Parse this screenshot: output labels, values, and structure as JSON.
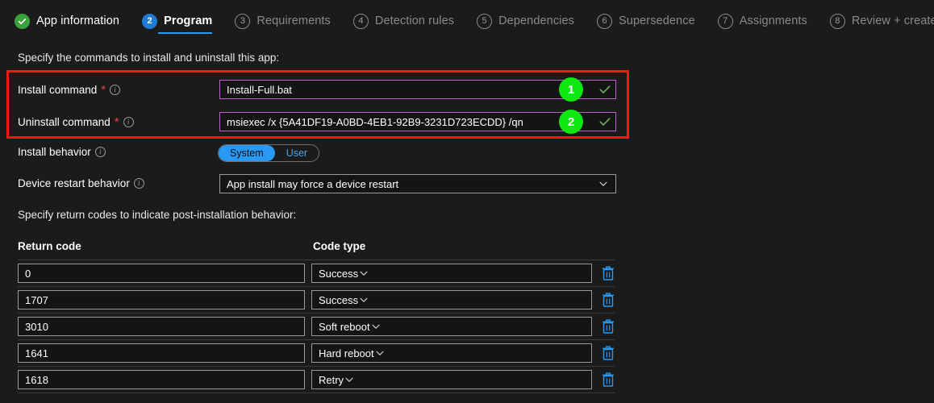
{
  "wizard": {
    "steps": [
      {
        "num": "",
        "label": "App information",
        "state": "done",
        "icon": "check-circle-icon"
      },
      {
        "num": "2",
        "label": "Program",
        "state": "active",
        "icon": ""
      },
      {
        "num": "3",
        "label": "Requirements",
        "state": "pending",
        "icon": ""
      },
      {
        "num": "4",
        "label": "Detection rules",
        "state": "pending",
        "icon": ""
      },
      {
        "num": "5",
        "label": "Dependencies",
        "state": "pending",
        "icon": ""
      },
      {
        "num": "6",
        "label": "Supersedence",
        "state": "pending",
        "icon": ""
      },
      {
        "num": "7",
        "label": "Assignments",
        "state": "pending",
        "icon": ""
      },
      {
        "num": "8",
        "label": "Review + create",
        "state": "pending",
        "icon": ""
      }
    ]
  },
  "commands": {
    "heading": "Specify the commands to install and uninstall this app:",
    "install_label": "Install command",
    "install_value": "Install-Full.bat",
    "install_required": "*",
    "uninstall_label": "Uninstall command",
    "uninstall_value": "msiexec /x {5A41DF19-A0BD-4EB1-92B9-3231D723ECDD} /qn",
    "uninstall_required": "*",
    "marker_1": "1",
    "marker_2": "2",
    "highlight_color": "#f51616",
    "field_border_color": "#c060d0",
    "marker_color": "#0fe80f"
  },
  "install_behavior": {
    "label": "Install behavior",
    "options": [
      "System",
      "User"
    ],
    "selected": "System",
    "accent": "#2899f5"
  },
  "device_restart": {
    "label": "Device restart behavior",
    "value": "App install may force a device restart"
  },
  "return_codes": {
    "heading": "Specify return codes to indicate post-installation behavior:",
    "columns": [
      "Return code",
      "Code type"
    ],
    "rows": [
      {
        "code": "0",
        "type": "Success"
      },
      {
        "code": "1707",
        "type": "Success"
      },
      {
        "code": "3010",
        "type": "Soft reboot"
      },
      {
        "code": "1641",
        "type": "Hard reboot"
      },
      {
        "code": "1618",
        "type": "Retry"
      }
    ],
    "delete_icon": "trash-icon",
    "delete_color": "#2899f5"
  }
}
